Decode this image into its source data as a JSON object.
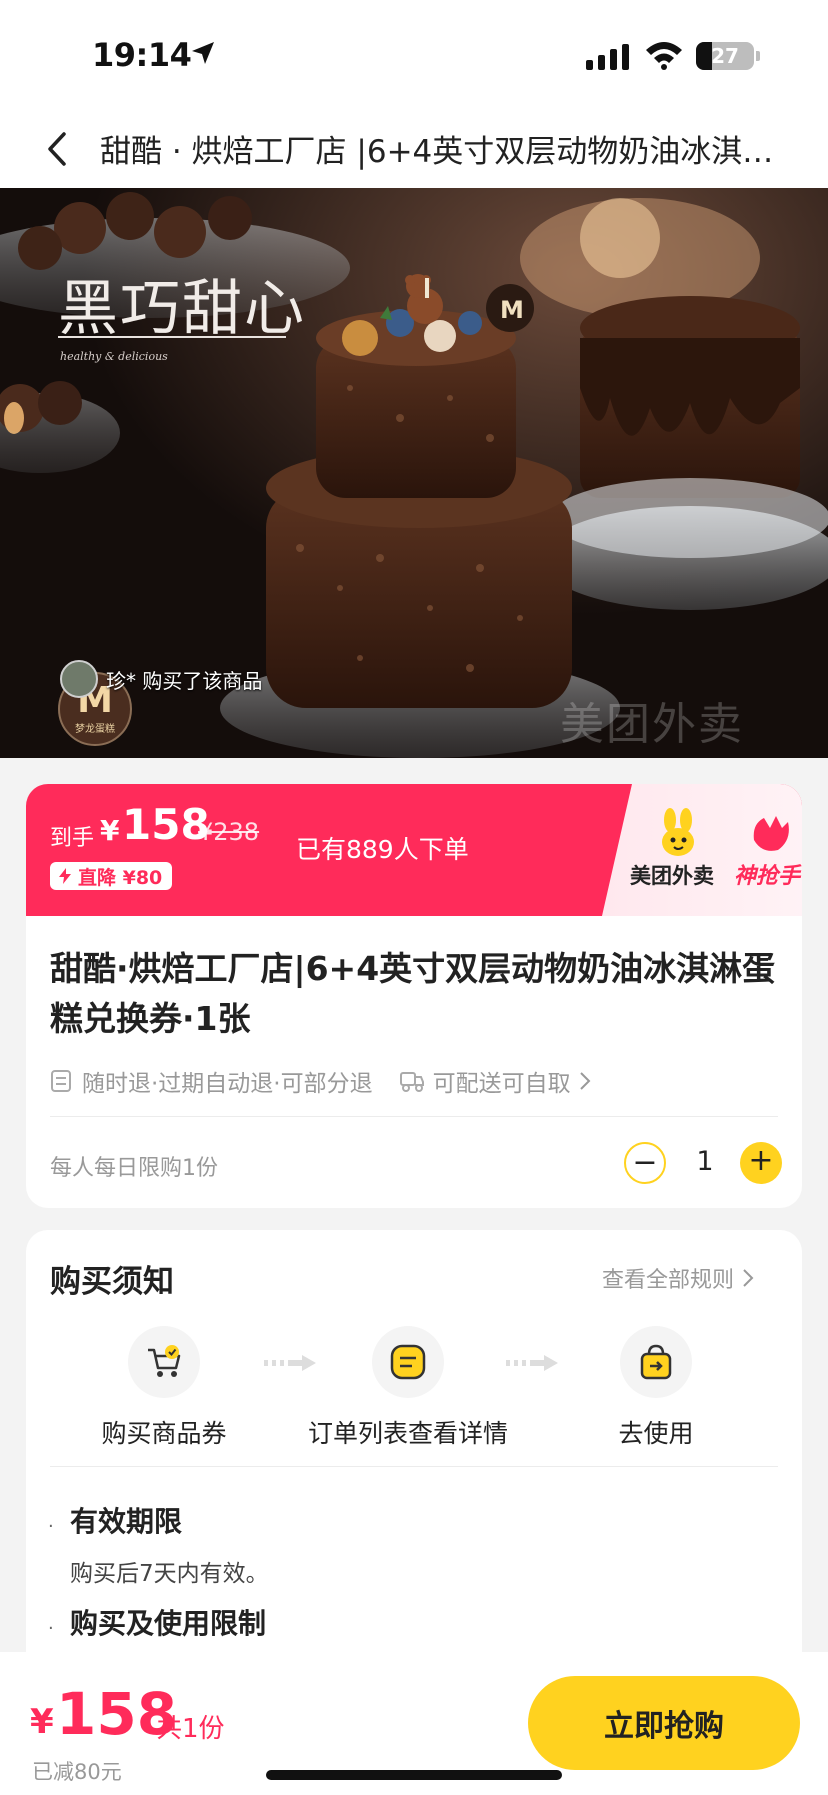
{
  "status_bar": {
    "time": "19:14",
    "battery_level": "27",
    "battery_fraction": 0.27
  },
  "nav": {
    "title": "甜酷 · 烘焙工厂店 |6+4英寸双层动物奶油冰淇淋蛋糕兑换券·1张"
  },
  "hero": {
    "brand_text": "黑巧甜心",
    "brand_subtext": "healthy & delicious",
    "buyer_text": "珍* 购买了该商品",
    "shop_logo_letter": "M",
    "shop_logo_name": "梦龙蛋糕",
    "watermark": "美团外卖"
  },
  "price_banner": {
    "prefix": "到手",
    "currency": "¥",
    "price": "158",
    "original_price": "¥238",
    "discount_tag": "直降 ¥80",
    "orders_text": "已有889人下单",
    "brand_meituan": "美团外卖",
    "brand_shenqiangshou": "神抢手",
    "colors": {
      "accent": "#ff2b5a",
      "yellow": "#ffd21f"
    }
  },
  "product": {
    "title": "甜酷·烘焙工厂店|6+4英寸双层动物奶油冰淇淋蛋糕兑换券·1张",
    "policy_text": "随时退·过期自动退·可部分退",
    "delivery_text": "可配送可自取",
    "limit_text": "每人每日限购1份",
    "quantity": "1",
    "minus_glyph": "−",
    "plus_glyph": "+"
  },
  "notice": {
    "title": "购买须知",
    "rules_link": "查看全部规则",
    "steps": [
      {
        "label": "购买商品券",
        "icon": "cart-check-icon"
      },
      {
        "label": "订单列表查看详情",
        "icon": "order-list-icon"
      },
      {
        "label": "去使用",
        "icon": "shopping-bag-icon"
      }
    ],
    "sections": [
      {
        "heading": "有效期限",
        "body": "购买后7天内有效。"
      },
      {
        "heading": "购买及使用限制",
        "body": ""
      }
    ],
    "bullet": "·"
  },
  "bottom_bar": {
    "currency": "¥",
    "total_price": "158",
    "count_text": "共1份",
    "saved_text": "已减80元",
    "buy_label": "立即抢购"
  }
}
